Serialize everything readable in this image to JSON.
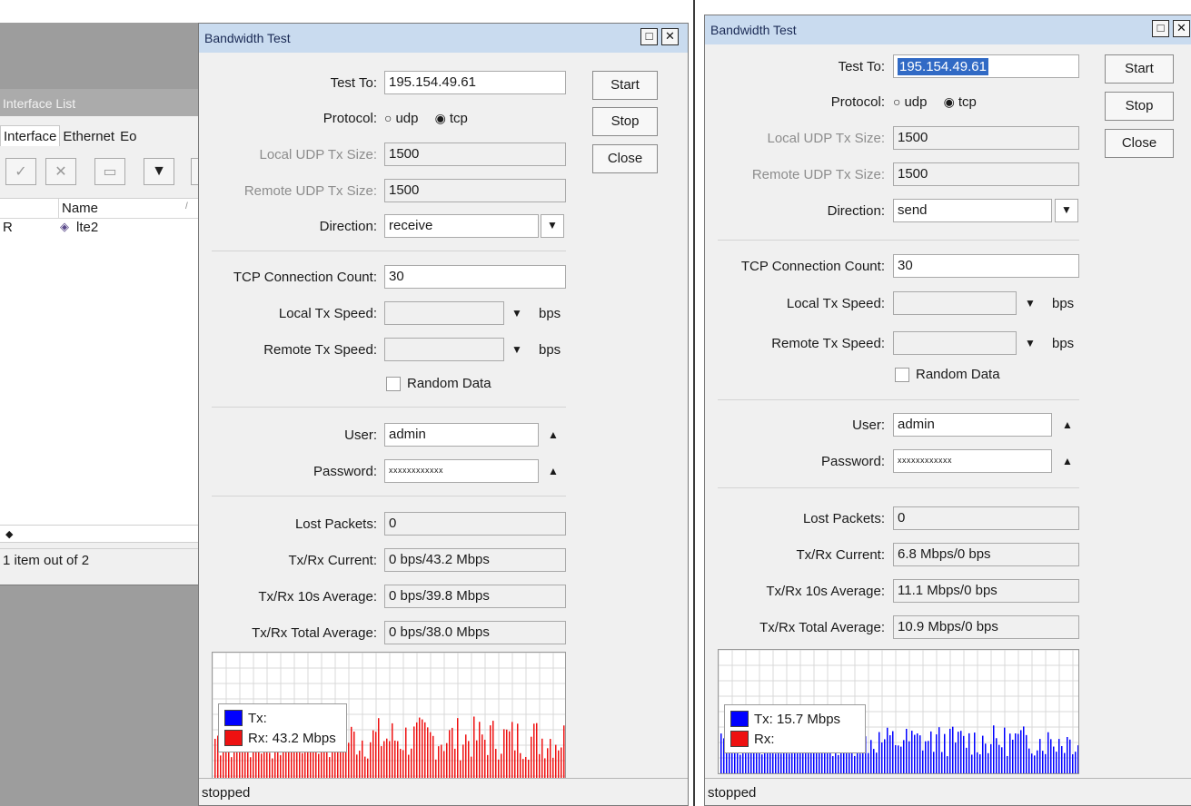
{
  "interface_list": {
    "title": "Interface List",
    "tabs": [
      "Interface",
      "Ethernet",
      "Eo"
    ],
    "columns": [
      "Name"
    ],
    "rows": [
      {
        "flag": "R",
        "name": "lte2"
      }
    ],
    "status": "1 item out of 2",
    "toolbar_icons": [
      "check-icon",
      "cross-icon",
      "comment-icon",
      "filter-icon"
    ]
  },
  "windows": [
    {
      "title": "Bandwidth Test",
      "fields": {
        "test_to": {
          "label": "Test To:",
          "value": "195.154.49.61"
        },
        "protocol": {
          "label": "Protocol:",
          "options": [
            "udp",
            "tcp"
          ],
          "selected": "tcp"
        },
        "local_udp": {
          "label": "Local UDP Tx Size:",
          "value": "1500"
        },
        "remote_udp": {
          "label": "Remote UDP Tx Size:",
          "value": "1500"
        },
        "direction": {
          "label": "Direction:",
          "value": "receive"
        },
        "tcp_count": {
          "label": "TCP Connection Count:",
          "value": "30"
        },
        "local_speed": {
          "label": "Local Tx Speed:",
          "unit": "bps"
        },
        "remote_speed": {
          "label": "Remote Tx Speed:",
          "unit": "bps"
        },
        "random_data": {
          "label": "Random Data",
          "checked": false
        },
        "user": {
          "label": "User:",
          "value": "admin"
        },
        "password": {
          "label": "Password:",
          "value": "xxxxxxxxxxxx"
        },
        "lost_packets": {
          "label": "Lost Packets:",
          "value": "0"
        },
        "current": {
          "label": "Tx/Rx Current:",
          "value": "0 bps/43.2 Mbps"
        },
        "avg10": {
          "label": "Tx/Rx 10s Average:",
          "value": "0 bps/39.8 Mbps"
        },
        "total_avg": {
          "label": "Tx/Rx Total Average:",
          "value": "0 bps/38.0 Mbps"
        }
      },
      "buttons": {
        "start": "Start",
        "stop": "Stop",
        "close": "Close"
      },
      "legend": {
        "tx": "Tx:",
        "rx": "Rx:  43.2 Mbps"
      },
      "status": "stopped"
    },
    {
      "title": "Bandwidth Test",
      "fields": {
        "test_to": {
          "label": "Test To:",
          "value": "195.154.49.61"
        },
        "protocol": {
          "label": "Protocol:",
          "options": [
            "udp",
            "tcp"
          ],
          "selected": "tcp"
        },
        "local_udp": {
          "label": "Local UDP Tx Size:",
          "value": "1500"
        },
        "remote_udp": {
          "label": "Remote UDP Tx Size:",
          "value": "1500"
        },
        "direction": {
          "label": "Direction:",
          "value": "send"
        },
        "tcp_count": {
          "label": "TCP Connection Count:",
          "value": "30"
        },
        "local_speed": {
          "label": "Local Tx Speed:",
          "unit": "bps"
        },
        "remote_speed": {
          "label": "Remote Tx Speed:",
          "unit": "bps"
        },
        "random_data": {
          "label": "Random Data",
          "checked": false
        },
        "user": {
          "label": "User:",
          "value": "admin"
        },
        "password": {
          "label": "Password:",
          "value": "xxxxxxxxxxxx"
        },
        "lost_packets": {
          "label": "Lost Packets:",
          "value": "0"
        },
        "current": {
          "label": "Tx/Rx Current:",
          "value": "6.8 Mbps/0 bps"
        },
        "avg10": {
          "label": "Tx/Rx 10s Average:",
          "value": "11.1 Mbps/0 bps"
        },
        "total_avg": {
          "label": "Tx/Rx Total Average:",
          "value": "10.9 Mbps/0 bps"
        }
      },
      "buttons": {
        "start": "Start",
        "stop": "Stop",
        "close": "Close"
      },
      "legend": {
        "tx": "Tx:  15.7 Mbps",
        "rx": "Rx:"
      },
      "status": "stopped"
    }
  ],
  "colors": {
    "tx": "#0000ff",
    "rx": "#ee1111",
    "title_bar": "#c9dbef"
  }
}
